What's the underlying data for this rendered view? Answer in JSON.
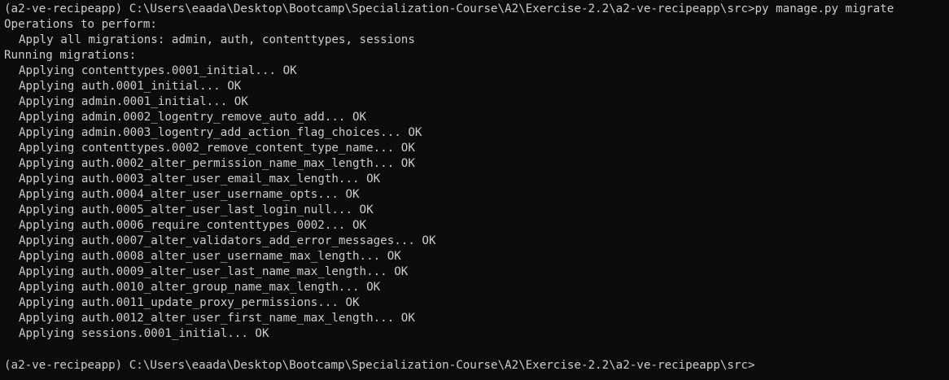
{
  "terminal": {
    "command_prompt": "(a2-ve-recipeapp) C:\\Users\\eaada\\Desktop\\Bootcamp\\Specialization-Course\\A2\\Exercise-2.2\\a2-ve-recipeapp\\src>py manage.py migrate",
    "operations_header": "Operations to perform:",
    "apply_all": "Apply all migrations: admin, auth, contenttypes, sessions",
    "running_header": "Running migrations:",
    "migrations": [
      "Applying contenttypes.0001_initial... OK",
      "Applying auth.0001_initial... OK",
      "Applying admin.0001_initial... OK",
      "Applying admin.0002_logentry_remove_auto_add... OK",
      "Applying admin.0003_logentry_add_action_flag_choices... OK",
      "Applying contenttypes.0002_remove_content_type_name... OK",
      "Applying auth.0002_alter_permission_name_max_length... OK",
      "Applying auth.0003_alter_user_email_max_length... OK",
      "Applying auth.0004_alter_user_username_opts... OK",
      "Applying auth.0005_alter_user_last_login_null... OK",
      "Applying auth.0006_require_contenttypes_0002... OK",
      "Applying auth.0007_alter_validators_add_error_messages... OK",
      "Applying auth.0008_alter_user_username_max_length... OK",
      "Applying auth.0009_alter_user_last_name_max_length... OK",
      "Applying auth.0010_alter_group_name_max_length... OK",
      "Applying auth.0011_update_proxy_permissions... OK",
      "Applying auth.0012_alter_user_first_name_max_length... OK",
      "Applying sessions.0001_initial... OK"
    ],
    "current_prompt": "(a2-ve-recipeapp) C:\\Users\\eaada\\Desktop\\Bootcamp\\Specialization-Course\\A2\\Exercise-2.2\\a2-ve-recipeapp\\src>",
    "colors": {
      "background": "#0c0c0c",
      "foreground": "#cccccc"
    }
  }
}
